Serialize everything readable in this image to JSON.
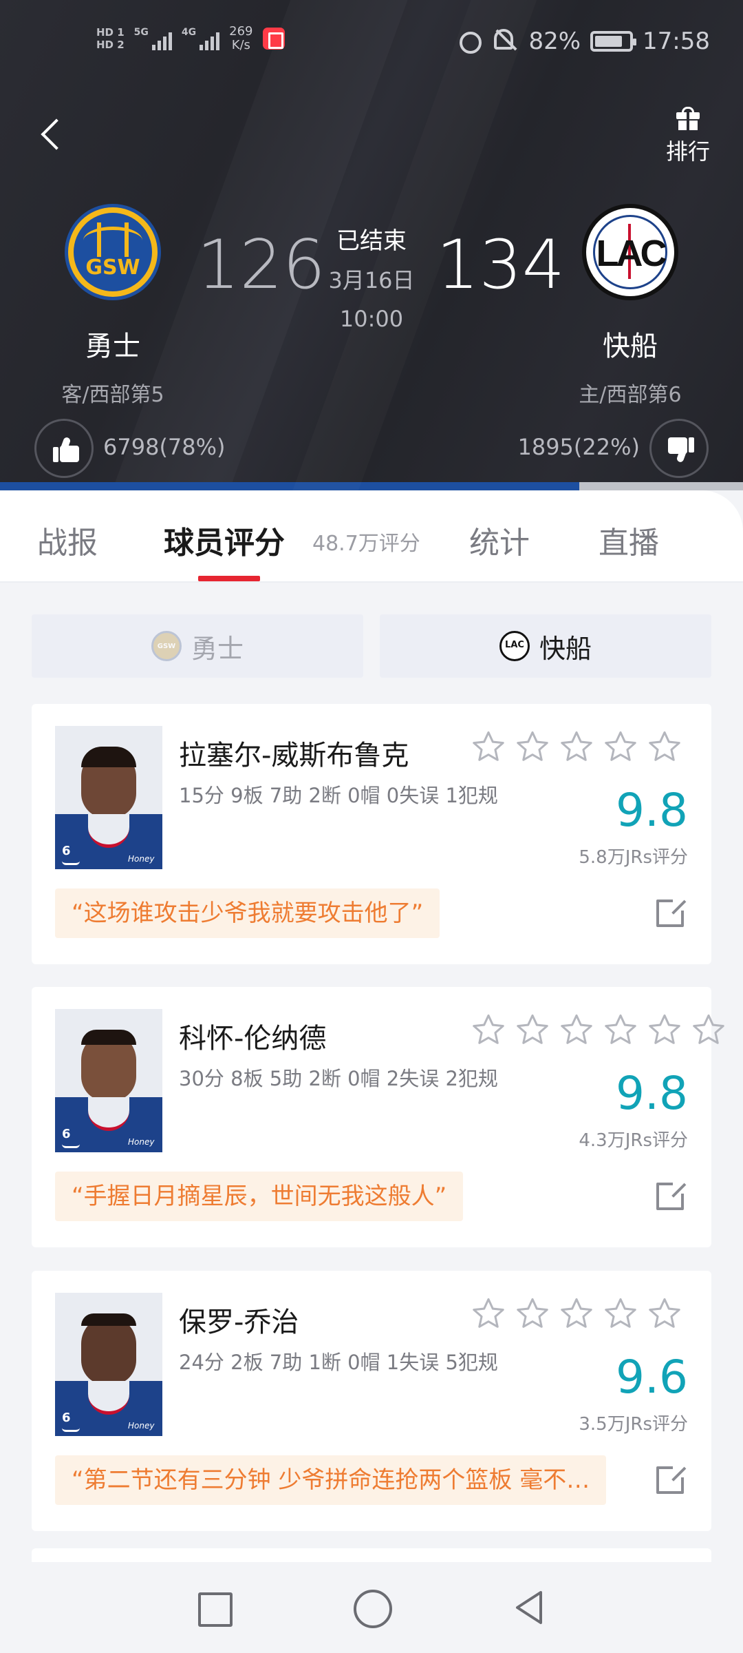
{
  "status_bar": {
    "net_speed_value": "269",
    "net_speed_unit": "K/s",
    "battery_percent": "82%",
    "battery_level": 0.82,
    "time": "17:58"
  },
  "header": {
    "rank_label": "排行",
    "away_team": {
      "name": "勇士",
      "abbr": "GSW",
      "sub": "客/西部第5",
      "score": "126"
    },
    "home_team": {
      "name": "快船",
      "abbr": "LAC",
      "sub": "主/西部第6",
      "score": "134"
    },
    "game_status": "已结束",
    "game_date": "3月16日",
    "game_time": "10:00",
    "away_votes": "6798(78%)",
    "home_votes": "1895(22%)",
    "away_vote_share": 0.78
  },
  "tabs": {
    "report": "战报",
    "rating": "球员评分",
    "rating_count": "48.7万评分",
    "stats": "统计",
    "live": "直播"
  },
  "team_switch": {
    "away": "勇士",
    "home": "快船"
  },
  "players": [
    {
      "name": "拉塞尔-威斯布鲁克",
      "stats": "15分 9板 7助 2断 0帽 0失误 1犯规",
      "rating": "9.8",
      "rating_count": "5.8万JRs评分",
      "quote": "“这场谁攻击少爷我就要攻击他了”",
      "jersey_number": "6",
      "jersey_brand": "Honey"
    },
    {
      "name": "科怀-伦纳德",
      "stats": "30分 8板 5助 2断 0帽 2失误 2犯规",
      "rating": "9.8",
      "rating_count": "4.3万JRs评分",
      "quote": "“手握日月摘星辰，世间无我这般人”",
      "jersey_number": "6",
      "jersey_brand": "Honey"
    },
    {
      "name": "保罗-乔治",
      "stats": "24分 2板 7助 1断 0帽 1失误 5犯规",
      "rating": "9.6",
      "rating_count": "3.5万JRs评分",
      "quote": "“第二节还有三分钟 少爷拼命连抢两个篮板 毫不…",
      "jersey_number": "6",
      "jersey_brand": "Honey"
    }
  ],
  "colors": {
    "accent_red": "#e62531",
    "rating_teal": "#11a3b7",
    "quote_orange": "#ee7c32",
    "warriors_blue": "#1d4fa0"
  },
  "icons": [
    "back-icon",
    "gift-icon",
    "thumb-up-icon",
    "thumb-down-icon",
    "star-icon",
    "share-icon",
    "alarm-icon",
    "mute-icon",
    "battery-icon"
  ]
}
